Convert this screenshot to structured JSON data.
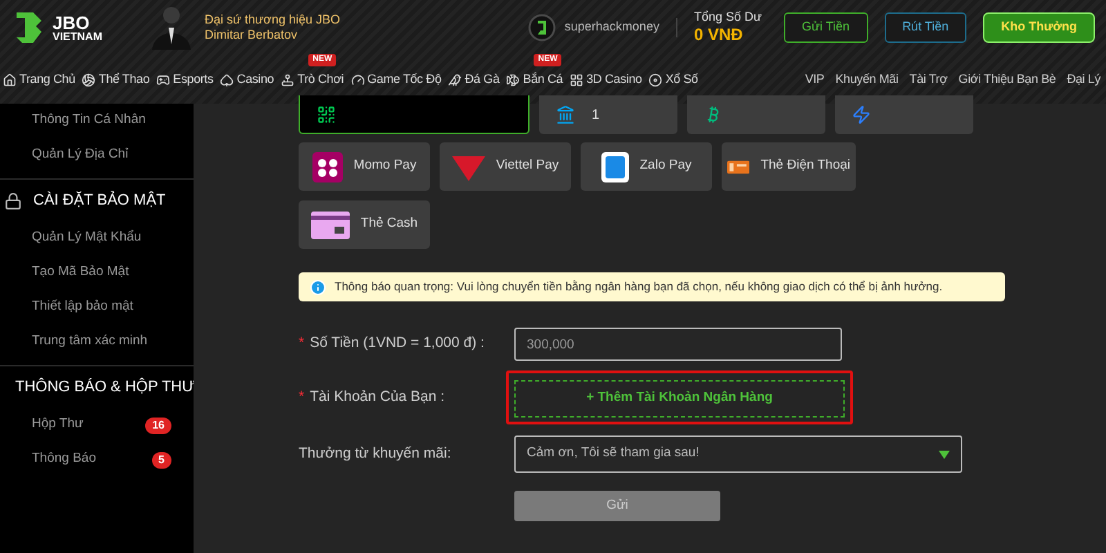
{
  "header": {
    "logo": {
      "line1": "JBO",
      "line2": "VIETNAM"
    },
    "ambassador": {
      "line1": "Đại sứ thương hiệu JBO",
      "line2": "Dimitar Berbatov"
    },
    "username": "superhackmoney",
    "balance": {
      "label": "Tổng Số Dư",
      "value": "0 VNĐ"
    },
    "buttons": [
      {
        "label": "Gửi Tiền",
        "kind": "deposit"
      },
      {
        "label": "Rút Tiền",
        "kind": "withdraw"
      },
      {
        "label": "Kho Thưởng",
        "kind": "rewards"
      }
    ]
  },
  "nav": {
    "items": [
      {
        "label": "Trang Chủ"
      },
      {
        "label": "Thể Thao"
      },
      {
        "label": "Esports"
      },
      {
        "label": "Casino"
      },
      {
        "label": "Trò Chơi",
        "badge": "NEW"
      },
      {
        "label": "Game Tốc Độ"
      },
      {
        "label": "Đá Gà"
      },
      {
        "label": "Bắn Cá",
        "badge": "NEW"
      },
      {
        "label": "3D Casino"
      },
      {
        "label": "Xổ Số"
      }
    ],
    "links": [
      "VIP",
      "Khuyến Mãi",
      "Tài Trợ",
      "Giới Thiệu Bạn Bè",
      "Đại Lý"
    ]
  },
  "sidebar": {
    "sections": [
      {
        "items": [
          {
            "label": "Thông Tin Cá Nhân"
          },
          {
            "label": "Quản Lý Địa Chỉ"
          }
        ]
      },
      {
        "title": "CÀI ĐẶT BẢO MẬT",
        "items": [
          {
            "label": "Quản Lý Mật Khẩu"
          },
          {
            "label": "Tạo Mã Bảo Mật"
          },
          {
            "label": "Thiết lập bảo mật"
          },
          {
            "label": "Trung tâm xác minh"
          }
        ]
      },
      {
        "title": "THÔNG BÁO & HỘP THƯ",
        "items": [
          {
            "label": "Hộp Thư",
            "badge": "16"
          },
          {
            "label": "Thông Báo",
            "badge": "5"
          }
        ]
      }
    ]
  },
  "payment_methods": {
    "top_row": [
      {
        "selected": true
      },
      {
        "text": "1",
        "selected": false
      },
      {
        "selected": false
      },
      {
        "selected": false
      }
    ],
    "options": [
      {
        "label": "Momo Pay",
        "selected": false
      },
      {
        "label": "Viettel Pay",
        "selected": false
      },
      {
        "label": "Zalo Pay",
        "selected": false
      },
      {
        "label": "Thẻ Điện Thoại",
        "selected": false
      },
      {
        "label": "Thẻ Cash",
        "selected": false
      }
    ]
  },
  "notice": "Thông báo quan trọng: Vui lòng chuyển tiền bằng ngân hàng bạn đã chọn, nếu không giao dịch có thể bị ảnh hưởng.",
  "form": {
    "amount": {
      "marker": "*",
      "label": "Số Tiền (1VND = 1,000 đ) :",
      "value": "300,000"
    },
    "account": {
      "marker": "*",
      "label": "Tài Khoản Của Bạn :",
      "add_label": "+ Thêm Tài Khoản Ngân Hàng",
      "highlighted": true
    },
    "promotion": {
      "label": "Thưởng từ khuyến mãi:",
      "value": "Cảm ơn, Tôi sẽ tham gia sau!"
    },
    "submit": {
      "label": "Gửi",
      "disabled": true
    }
  }
}
